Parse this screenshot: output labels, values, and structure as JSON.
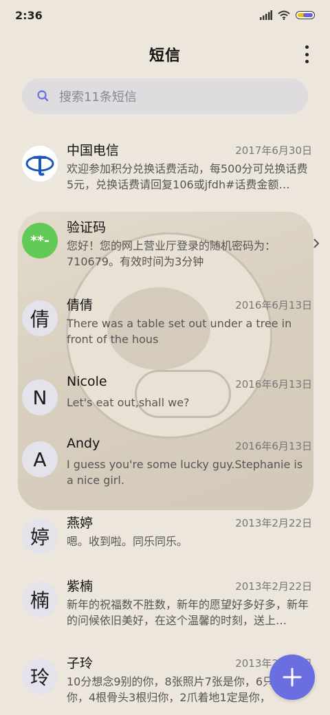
{
  "status_bar": {
    "time": "2:36",
    "icons": [
      "signal-icon",
      "wifi-icon",
      "battery-icon"
    ]
  },
  "header": {
    "title": "短信",
    "menu_icon": "more-vertical-icon"
  },
  "search": {
    "placeholder": "搜索11条短信",
    "icon": "search-icon"
  },
  "conversations": [
    {
      "avatar": "telecom-logo",
      "name": "中国电信",
      "date": "2017年6月30日",
      "preview": "欢迎参加积分兑换话费活动，每500分可兑换话费5元，兑换话费请回复106或jfdh#话费金额…"
    },
    {
      "avatar": "**-",
      "name": "验证码",
      "date": "",
      "preview": "您好！您的网上营业厅登录的随机密码为：710679。有效时间为3分钟"
    },
    {
      "avatar": "倩",
      "name": "倩倩",
      "date": "2016年6月13日",
      "preview": "There was a table set out under a tree in front of the hous"
    },
    {
      "avatar": "N",
      "name": "Nicole",
      "date": "2016年6月13日",
      "preview": "Let's eat out,shall we?"
    },
    {
      "avatar": "A",
      "name": "Andy",
      "date": "2016年6月13日",
      "preview": "I guess you're some lucky guy.Stephanie is a nice girl."
    },
    {
      "avatar": "婷",
      "name": "燕婷",
      "date": "2013年2月22日",
      "preview": "嗯。收到啦。同乐同乐。"
    },
    {
      "avatar": "楠",
      "name": "紫楠",
      "date": "2013年2月22日",
      "preview": "新年的祝福数不胜数，新年的愿望好多好多，新年的问候依旧美好，在这个温馨的时刻，送上…"
    },
    {
      "avatar": "玲",
      "name": "子玲",
      "date": "2013年2月22日",
      "preview": "10分想念9别的你，8张照片7张是你，6只…只像你，4根骨头3根归你，2爪着地1定是你，"
    }
  ],
  "fab": {
    "icon": "plus-icon"
  },
  "colors": {
    "accent": "#6a6ee0",
    "background": "#ece6dc",
    "green_avatar": "#63c956"
  }
}
